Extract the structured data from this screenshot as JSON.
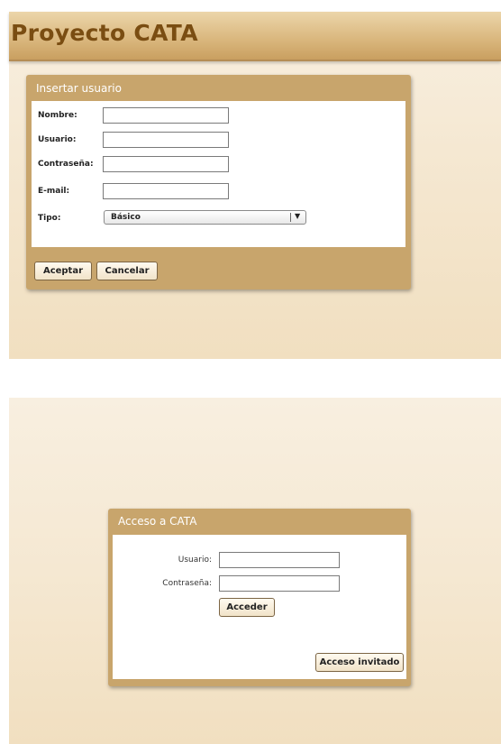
{
  "app": {
    "title": "Proyecto CATA"
  },
  "insert_user": {
    "title": "Insertar usuario",
    "fields": {
      "nombre": {
        "label": "Nombre:",
        "value": ""
      },
      "usuario": {
        "label": "Usuario:",
        "value": ""
      },
      "contrasena": {
        "label": "Contraseña:",
        "value": ""
      },
      "email": {
        "label": "E-mail:",
        "value": ""
      },
      "tipo": {
        "label": "Tipo:",
        "selected": "Básico"
      }
    },
    "buttons": {
      "accept": "Aceptar",
      "cancel": "Cancelar"
    }
  },
  "login": {
    "title": "Acceso a CATA",
    "fields": {
      "usuario": {
        "label": "Usuario:",
        "value": ""
      },
      "contrasena": {
        "label": "Contraseña:",
        "value": ""
      }
    },
    "buttons": {
      "access": "Acceder",
      "guest": "Acceso invitado"
    }
  },
  "colors": {
    "header": "#d9b67c",
    "title_text": "#7a4d12",
    "panel": "#c8a56c",
    "background": "#f5e8d2"
  },
  "icons": {
    "select_arrow": "▼"
  }
}
